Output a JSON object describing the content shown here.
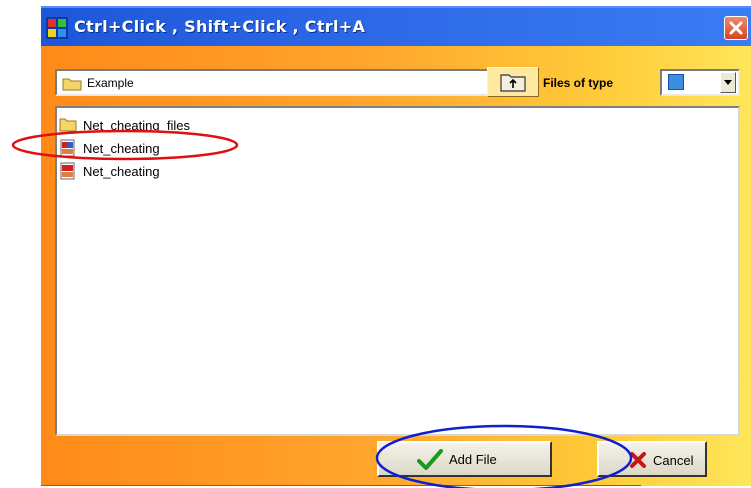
{
  "dialog": {
    "title": "Ctrl+Click , Shift+Click , Ctrl+A",
    "close_glyph": "✕"
  },
  "toolbar": {
    "current_folder": "Example",
    "files_of_type_label": "Files of type",
    "up_icon": "folder-up-icon"
  },
  "file_list": {
    "items": [
      {
        "label": "Net_cheating_files",
        "icon": "folder-icon"
      },
      {
        "label": "Net_cheating",
        "icon": "web-page-icon",
        "highlighted": true
      },
      {
        "label": "Net_cheating",
        "icon": "web-page-icon"
      }
    ]
  },
  "buttons": {
    "add_file": "Add File",
    "cancel": "Cancel"
  },
  "colors": {
    "title_bar": "#2e6ae8",
    "dialog_gradient_start": "#ff8a18",
    "dialog_gradient_end": "#ffe65a",
    "highlight_red": "#e01010",
    "highlight_blue": "#1020d0",
    "check_green": "#1a9a1a",
    "cancel_red": "#c81414"
  }
}
